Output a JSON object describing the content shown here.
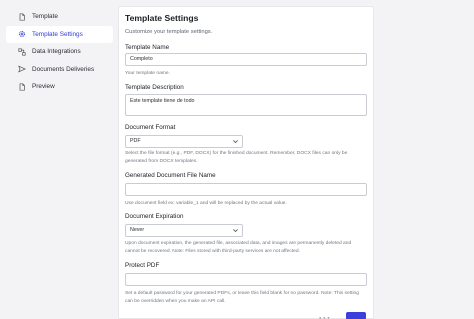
{
  "sidebar": {
    "items": [
      {
        "label": "Template",
        "icon": "document-icon",
        "active": false
      },
      {
        "label": "Template Settings",
        "icon": "gear-icon",
        "active": true
      },
      {
        "label": "Data Integrations",
        "icon": "data-integrations-icon",
        "active": false
      },
      {
        "label": "Documents Deliveries",
        "icon": "send-icon",
        "active": false
      },
      {
        "label": "Preview",
        "icon": "preview-document-icon",
        "active": false
      }
    ]
  },
  "main": {
    "title": "Template Settings",
    "subtitle": "Customize your template settings.",
    "template_name": {
      "label": "Template Name",
      "value": "Completo",
      "help": "Your template name."
    },
    "template_description": {
      "label": "Template Description",
      "value": "Este template tiene de todo"
    },
    "document_format": {
      "label": "Document Format",
      "value": "PDF",
      "help": "Select the file format (e.g., PDF, DOCX) for the finished document. Remember, DOCX files can only be generated from DOCX templates."
    },
    "generated_file_name": {
      "label": "Generated Document File Name",
      "value": "",
      "help": "Use document field ex: variable_1 and will be replaced by the actual value."
    },
    "document_expiration": {
      "label": "Document Expiration",
      "value": "Never",
      "help": "Upon document expiration, the generated file, associated data, and images are permanently deleted and cannot be recovered. Note: Files stored with third-party services are not affected."
    },
    "protect_pdf": {
      "label": "Protect PDF",
      "value": "",
      "help": "Set a default password for your generated PDFs, or leave this field blank for no password. Note: This setting can be overridden when you make an API call."
    }
  },
  "colors": {
    "accent": "#2d3fd0",
    "button": "#3b3fdc",
    "background": "#f3f3f5"
  }
}
